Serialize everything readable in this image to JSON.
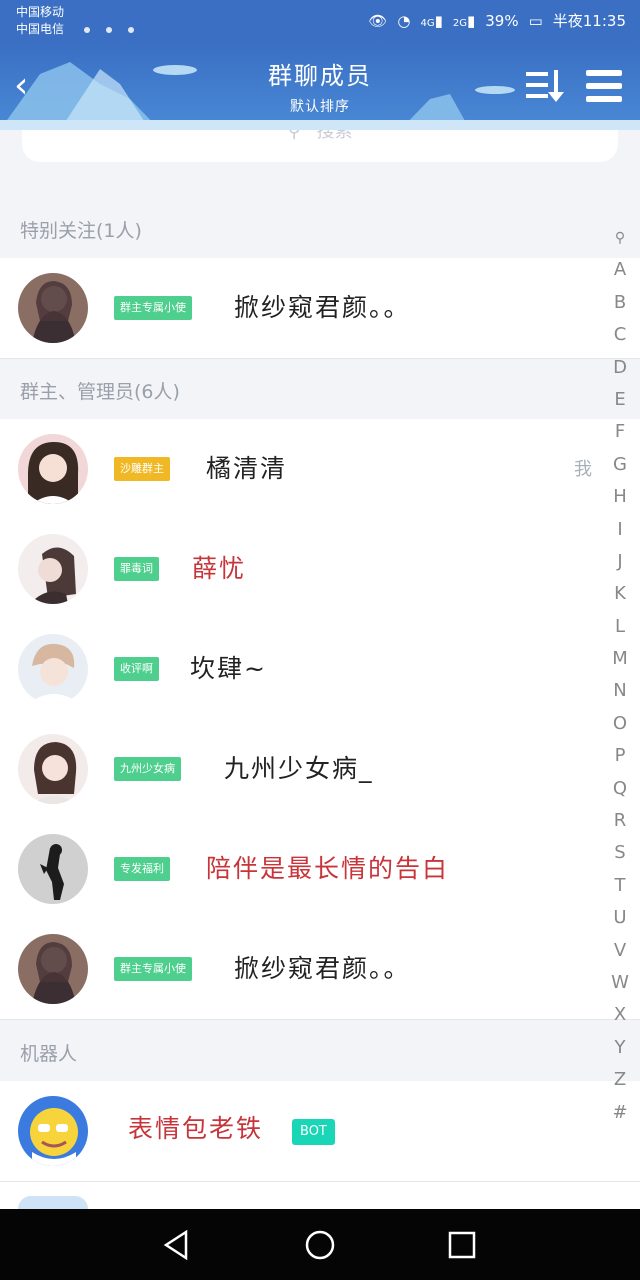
{
  "status": {
    "carrier_1": "中国移动",
    "carrier_2": "中国电信",
    "signal_4g": "4G",
    "signal_2g": "2G",
    "battery": "39%",
    "time": "半夜11:35"
  },
  "header": {
    "title": "群聊成员",
    "subtitle": "默认排序"
  },
  "search": {
    "placeholder": "搜索"
  },
  "sections": {
    "special": "特别关注(1人)",
    "admins": "群主、管理员(6人)",
    "bots": "机器人"
  },
  "members": {
    "special": [
      {
        "badge": "群主专属小使",
        "name": "掀纱窥君颜。。"
      }
    ],
    "admins": [
      {
        "badge": "沙雕群主",
        "name": "橘清清",
        "tag": "我"
      },
      {
        "badge": "罪毒词",
        "name": "薛忧"
      },
      {
        "badge": "收评啊",
        "name": "坎肆~"
      },
      {
        "badge": "九州少女病",
        "name": "九州少女病_"
      },
      {
        "badge": "专发福利",
        "name": "陪伴是最长情的告白"
      },
      {
        "badge": "群主专属小使",
        "name": "掀纱窥君颜。。"
      }
    ],
    "bots": [
      {
        "name": "表情包老铁",
        "tag": "BOT"
      }
    ]
  },
  "index_letters": [
    "A",
    "B",
    "C",
    "D",
    "E",
    "F",
    "G",
    "H",
    "I",
    "J",
    "K",
    "L",
    "M",
    "N",
    "O",
    "P",
    "Q",
    "R",
    "S",
    "T",
    "U",
    "V",
    "W",
    "X",
    "Y",
    "Z",
    "#"
  ],
  "colors": {
    "header_blue": "#3a6fc4",
    "badge_green": "#4fcf8e",
    "badge_gold": "#f0b824",
    "name_red": "#c7353a",
    "bot_teal": "#19d6b6"
  }
}
